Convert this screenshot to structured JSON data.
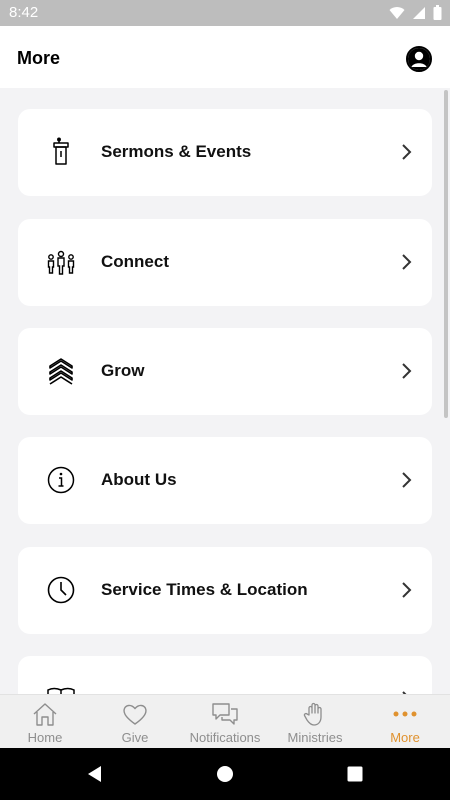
{
  "status_bar": {
    "time": "8:42"
  },
  "header": {
    "title": "More",
    "profile_icon": "account-circle-icon"
  },
  "menu_items": [
    {
      "label": "Sermons & Events",
      "icon": "podium-icon"
    },
    {
      "label": "Connect",
      "icon": "people-icon"
    },
    {
      "label": "Grow",
      "icon": "chevrons-up-icon"
    },
    {
      "label": "About Us",
      "icon": "info-icon"
    },
    {
      "label": "Service Times & Location",
      "icon": "clock-icon"
    },
    {
      "label": "",
      "icon": "book-icon"
    }
  ],
  "tabs": [
    {
      "label": "Home",
      "icon": "home-icon"
    },
    {
      "label": "Give",
      "icon": "heart-icon"
    },
    {
      "label": "Notifications",
      "icon": "chat-bubbles-icon"
    },
    {
      "label": "Ministries",
      "icon": "hand-icon"
    },
    {
      "label": "More",
      "icon": "more-dots-icon",
      "active": true
    }
  ],
  "colors": {
    "accent": "#e0922f",
    "background": "#f3f3f5",
    "card": "#ffffff",
    "inactive_tab": "#8e8e8e"
  }
}
